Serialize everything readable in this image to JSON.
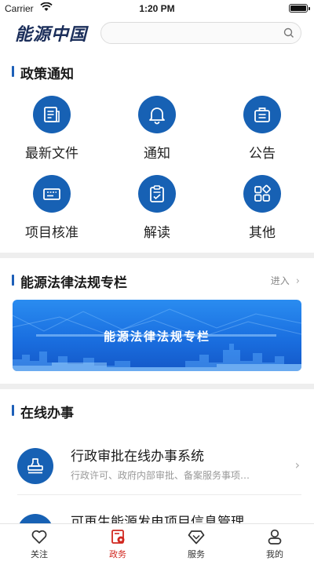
{
  "status": {
    "carrier": "Carrier",
    "time": "1:20 PM"
  },
  "header": {
    "logo": "能源中国",
    "search_placeholder": ""
  },
  "policy": {
    "title": "政策通知",
    "items": [
      {
        "label": "最新文件",
        "icon": "document-icon"
      },
      {
        "label": "通知",
        "icon": "bell-icon"
      },
      {
        "label": "公告",
        "icon": "briefcase-icon"
      },
      {
        "label": "项目核准",
        "icon": "ticket-icon"
      },
      {
        "label": "解读",
        "icon": "clipboard-check-icon"
      },
      {
        "label": "其他",
        "icon": "apps-icon"
      }
    ]
  },
  "law": {
    "title": "能源法律法规专栏",
    "more": "进入",
    "banner_title": "能源法律法规专栏"
  },
  "online": {
    "title": "在线办事",
    "items": [
      {
        "title": "行政审批在线办事系统",
        "desc": "行政许可、政府内部审批、备案服务事项…",
        "icon": "stamp-icon"
      },
      {
        "title": "可再生能源发电项目信息管理…",
        "desc": "",
        "icon": "circle-icon"
      }
    ]
  },
  "tabs": [
    {
      "label": "关注",
      "icon": "heart-icon",
      "active": false
    },
    {
      "label": "政务",
      "icon": "government-affairs-icon",
      "active": true
    },
    {
      "label": "服务",
      "icon": "diamond-icon",
      "active": false
    },
    {
      "label": "我的",
      "icon": "user-icon",
      "active": false
    }
  ],
  "colors": {
    "primary": "#1761b4",
    "accent": "#d1271f",
    "banner": "#1a6fe0"
  }
}
